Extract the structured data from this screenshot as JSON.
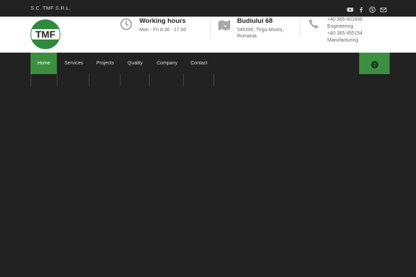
{
  "topbar": {
    "company_name": "S.C. TMF S.R.L.",
    "social_icons": [
      "youtube-icon",
      "facebook-icon",
      "skype-icon",
      "mail-icon"
    ]
  },
  "logo": {
    "text": "TMF"
  },
  "info": {
    "hours": {
      "title": "Working hours",
      "line1": "Mon - Fri 8.30 - 17.00"
    },
    "address": {
      "title": "Budiului 68",
      "line1": "540390, Tîrgu-Mureș,",
      "line2": "Romania"
    },
    "phone": {
      "line1": "+40 365 401836",
      "line2": "Engineering",
      "line3": "+40 365 455154",
      "line4": "Manufacturing"
    }
  },
  "nav": {
    "items": [
      {
        "label": "Home",
        "active": true
      },
      {
        "label": "Services"
      },
      {
        "label": "Projects"
      },
      {
        "label": "Quality"
      },
      {
        "label": "Company"
      },
      {
        "label": "Contact"
      }
    ]
  },
  "colors": {
    "accent": "#3c8f3f",
    "background": "#222222",
    "header_bg": "#ffffff"
  }
}
